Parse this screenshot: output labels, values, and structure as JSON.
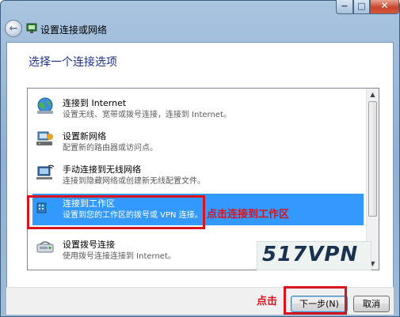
{
  "window": {
    "title": "设置连接或网络",
    "controls": {
      "minimize": "−",
      "maximize": "□",
      "close": "✕"
    }
  },
  "header": {
    "back_icon": "back-arrow-icon",
    "heading": "选择一个连接选项"
  },
  "options": [
    {
      "title": "连接到 Internet",
      "desc": "设置无线、宽带或拨号连接，连接到 Internet。",
      "icon": "globe-network-icon"
    },
    {
      "title": "设置新网络",
      "desc": "配置新的路由器或访问点。",
      "icon": "router-setup-icon"
    },
    {
      "title": "手动连接到无线网络",
      "desc": "连接到隐藏网络或创建新无线配置文件。",
      "icon": "wireless-computer-icon"
    },
    {
      "title": "连接到工作区",
      "desc": "设置到您的工作区的拨号或 VPN 连接。",
      "icon": "workplace-vpn-icon"
    },
    {
      "title": "设置拨号连接",
      "desc": "使用拨号连接连接到 Internet。",
      "icon": "dialup-modem-icon"
    }
  ],
  "selected_index": 3,
  "annotations": {
    "workplace": "点击连接到工作区",
    "next": "点击"
  },
  "watermark": "517VPN",
  "footer": {
    "next_label": "下一步(N)",
    "cancel_label": "取消"
  },
  "colors": {
    "selection": "#3399ff",
    "annotation_red": "#d9141c",
    "heading_blue": "#1e3287"
  }
}
